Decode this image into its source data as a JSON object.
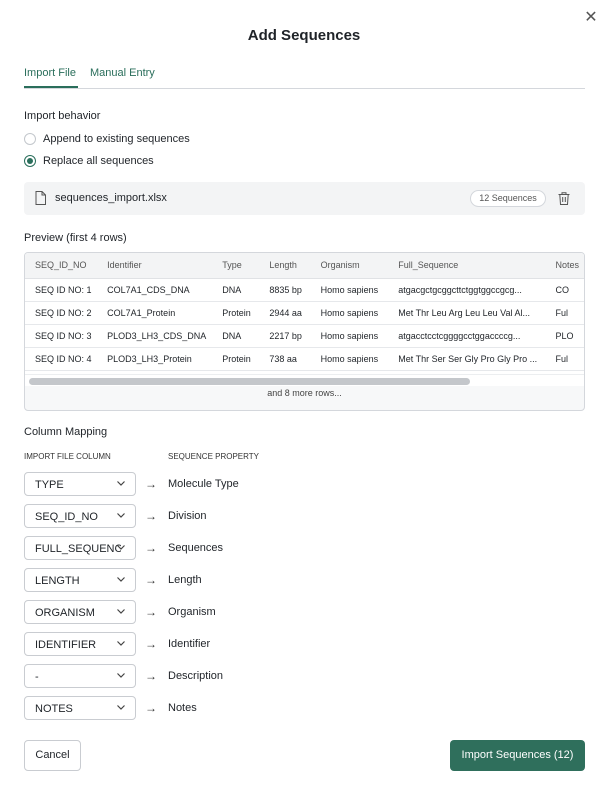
{
  "dialog": {
    "title": "Add Sequences",
    "close_icon": "close-icon"
  },
  "tabs": [
    {
      "label": "Import File",
      "active": true
    },
    {
      "label": "Manual Entry",
      "active": false
    }
  ],
  "import_behavior": {
    "label": "Import behavior",
    "options": [
      {
        "label": "Append to existing sequences",
        "selected": false
      },
      {
        "label": "Replace all sequences",
        "selected": true
      }
    ]
  },
  "file": {
    "icon": "file-icon",
    "name": "sequences_import.xlsx",
    "badge": "12 Sequences",
    "delete_icon": "trash-icon"
  },
  "preview": {
    "label": "Preview (first 4 rows)",
    "columns": [
      "SEQ_ID_NO",
      "Identifier",
      "Type",
      "Length",
      "Organism",
      "Full_Sequence",
      "Notes"
    ],
    "rows": [
      [
        "SEQ ID NO: 1",
        "COL7A1_CDS_DNA",
        "DNA",
        "8835 bp",
        "Homo sapiens",
        "atgacgctgcggcttctggtggccgcg...",
        "CO"
      ],
      [
        "SEQ ID NO: 2",
        "COL7A1_Protein",
        "Protein",
        "2944 aa",
        "Homo sapiens",
        "Met Thr Leu Arg Leu Leu Val Al...",
        "Ful"
      ],
      [
        "SEQ ID NO: 3",
        "PLOD3_LH3_CDS_DNA",
        "DNA",
        "2217 bp",
        "Homo sapiens",
        "atgacctcctcggggcctggaccccg...",
        "PLO"
      ],
      [
        "SEQ ID NO: 4",
        "PLOD3_LH3_Protein",
        "Protein",
        "738 aa",
        "Homo sapiens",
        "Met Thr Ser Ser Gly Pro Gly Pro ...",
        "Ful"
      ]
    ],
    "more_rows": "and 8 more rows..."
  },
  "mapping": {
    "label": "Column Mapping",
    "col_import": "IMPORT FILE COLUMN",
    "col_property": "SEQUENCE PROPERTY",
    "arrow": "→",
    "rows": [
      {
        "source": "TYPE",
        "target": "Molecule Type"
      },
      {
        "source": "SEQ_ID_NO",
        "target": "Division"
      },
      {
        "source": "FULL_SEQUENCE",
        "target": "Sequences"
      },
      {
        "source": "LENGTH",
        "target": "Length"
      },
      {
        "source": "ORGANISM",
        "target": "Organism"
      },
      {
        "source": "IDENTIFIER",
        "target": "Identifier"
      },
      {
        "source": "-",
        "target": "Description"
      },
      {
        "source": "NOTES",
        "target": "Notes"
      }
    ]
  },
  "footer": {
    "cancel_label": "Cancel",
    "import_label": "Import Sequences (12)"
  },
  "colors": {
    "accent": "#2f6f5c",
    "tab_accent": "#2a6e5b"
  }
}
